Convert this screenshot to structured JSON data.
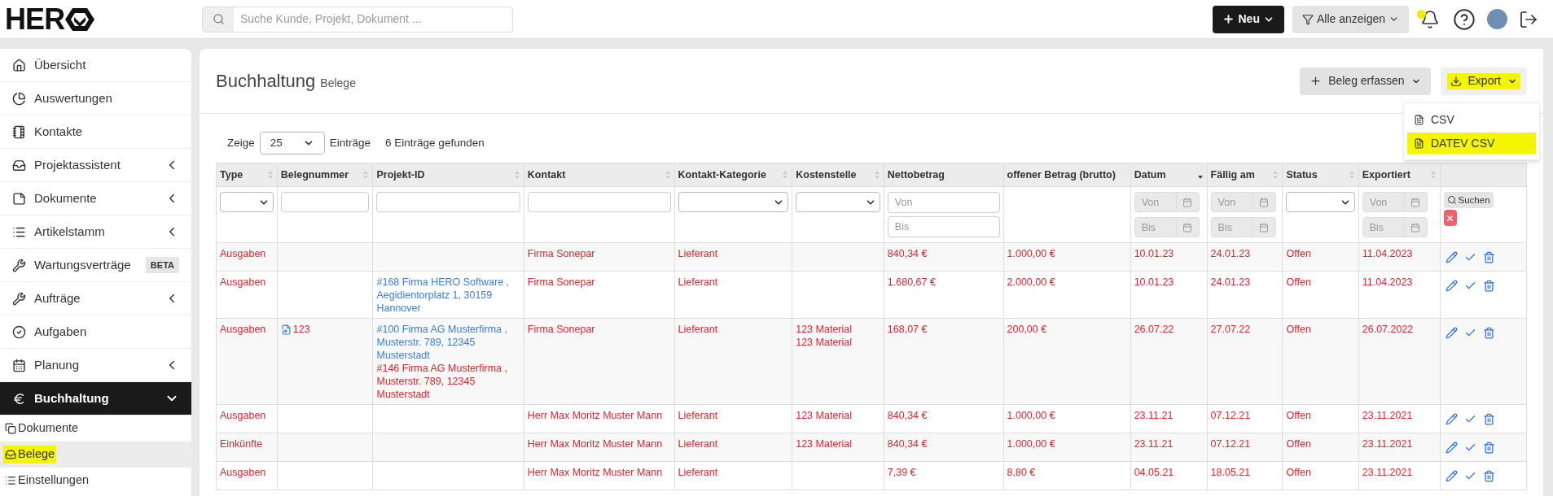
{
  "header": {
    "logo": "HER",
    "search": {
      "placeholder": "Suche Kunde, Projekt, Dokument ..."
    },
    "new_button": "Neu",
    "filter_button": "Alle anzeigen",
    "notification_highlighted": true
  },
  "sidebar": {
    "items": [
      {
        "label": "Übersicht",
        "expandable": false,
        "selected": false
      },
      {
        "label": "Auswertungen",
        "expandable": false,
        "selected": false
      },
      {
        "label": "Kontakte",
        "expandable": false,
        "selected": false
      },
      {
        "label": "Projektassistent",
        "expandable": true,
        "expanded": false,
        "selected": false
      },
      {
        "label": "Dokumente",
        "expandable": true,
        "expanded": false,
        "selected": false
      },
      {
        "label": "Artikelstamm",
        "expandable": true,
        "expanded": false,
        "selected": false
      },
      {
        "label": "Wartungsverträge",
        "badge": "BETA",
        "expandable": false,
        "selected": false
      },
      {
        "label": "Aufträge",
        "expandable": true,
        "expanded": false,
        "selected": false
      },
      {
        "label": "Aufgaben",
        "expandable": false,
        "selected": false
      },
      {
        "label": "Planung",
        "expandable": true,
        "expanded": false,
        "selected": false
      },
      {
        "label": "Buchhaltung",
        "expandable": true,
        "expanded": true,
        "selected": true,
        "children": [
          {
            "label": "Dokumente",
            "selected": false,
            "highlighted": false
          },
          {
            "label": "Belege",
            "selected": true,
            "highlighted": true
          },
          {
            "label": "Einstellungen",
            "selected": false,
            "highlighted": false
          }
        ]
      }
    ]
  },
  "page": {
    "title": "Buchhaltung",
    "subtitle": "Belege",
    "add_button": "Beleg erfassen",
    "export_button": {
      "label": "Export",
      "highlighted": true
    },
    "export_menu": [
      {
        "label": "CSV",
        "highlighted": false
      },
      {
        "label": "DATEV CSV",
        "highlighted": true
      }
    ]
  },
  "table": {
    "show_label": "Zeige",
    "page_size": "25",
    "entries_label": "Einträge",
    "found": "6 Einträge gefunden",
    "columns": [
      {
        "label": "Type",
        "sorted": false,
        "filter": {
          "kind": "select"
        }
      },
      {
        "label": "Belegnummer",
        "sorted": false,
        "filter": {
          "kind": "text"
        }
      },
      {
        "label": "Projekt-ID",
        "sorted": false,
        "filter": {
          "kind": "text"
        }
      },
      {
        "label": "Kontakt",
        "sorted": false,
        "filter": {
          "kind": "text"
        }
      },
      {
        "label": "Kontakt-Kategorie",
        "sorted": false,
        "filter": {
          "kind": "select"
        }
      },
      {
        "label": "Kostenstelle",
        "sorted": false,
        "filter": {
          "kind": "select"
        }
      },
      {
        "label": "Nettobetrag",
        "filter": {
          "kind": "range",
          "from": "Von",
          "to": "Bis"
        }
      },
      {
        "label": "offener Betrag (brutto)",
        "filter": {
          "kind": "none"
        }
      },
      {
        "label": "Datum",
        "sorted": true,
        "filter": {
          "kind": "date_range",
          "from": "Von",
          "to": "Bis"
        }
      },
      {
        "label": "Fällig am",
        "sorted": false,
        "filter": {
          "kind": "date_range",
          "from": "Von",
          "to": "Bis"
        }
      },
      {
        "label": "Status",
        "sorted": false,
        "filter": {
          "kind": "select"
        }
      },
      {
        "label": "Exportiert",
        "sorted": false,
        "filter": {
          "kind": "date_range",
          "from": "Von",
          "to": "Bis"
        }
      },
      {
        "filter": {
          "kind": "buttons",
          "search": "Suchen"
        }
      }
    ],
    "rows": [
      {
        "cells": [
          "Ausgaben",
          null,
          null,
          "Firma Sonepar",
          "Lieferant",
          null,
          "840,34 €",
          "1.000,00 €",
          "10.01.23",
          "24.01.23",
          "Offen",
          "11.04.2023"
        ]
      },
      {
        "cells": [
          "Ausgaben",
          null,
          [
            {
              "text": "#168 Firma HERO Software , Aegidientorplatz 1, 30159 Hannover",
              "kind": "link"
            }
          ],
          "Firma Sonepar",
          "Lieferant",
          null,
          "1.680,67 €",
          "2.000,00 €",
          "10.01.23",
          "24.01.23",
          "Offen",
          "11.04.2023"
        ]
      },
      {
        "cells": [
          "Ausgaben",
          {
            "text": "123",
            "icon": true
          },
          [
            {
              "text": "#100 Firma AG Musterfirma , Musterstr. 789, 12345 Musterstadt",
              "kind": "link"
            },
            {
              "text": "#146 Firma AG Musterfirma , Musterstr. 789, 12345 Musterstadt",
              "kind": "text"
            }
          ],
          "Firma Sonepar",
          "Lieferant",
          [
            "123 Material",
            "123 Material"
          ],
          "168,07 €",
          "200,00 €",
          "26.07.22",
          "27.07.22",
          "Offen",
          "26.07.2022"
        ]
      },
      {
        "cells": [
          "Ausgaben",
          null,
          null,
          "Herr Max Moritz Muster Mann",
          "Lieferant",
          "123 Material",
          "840,34 €",
          "1.000,00 €",
          "23.11.21",
          "07.12.21",
          "Offen",
          "23.11.2021"
        ]
      },
      {
        "cells": [
          "Einkünfte",
          null,
          null,
          "Herr Max Moritz Muster Mann",
          "Lieferant",
          "123 Material",
          "840,34 €",
          "1.000,00 €",
          "23.11.21",
          "07.12.21",
          "Offen",
          "23.11.2021"
        ]
      },
      {
        "cells": [
          "Ausgaben",
          null,
          null,
          "Herr Max Moritz Muster Mann",
          "Lieferant",
          null,
          "7,39 €",
          "8,80 €",
          "04.05.21",
          "18.05.21",
          "Offen",
          "23.11.2021"
        ]
      }
    ]
  }
}
